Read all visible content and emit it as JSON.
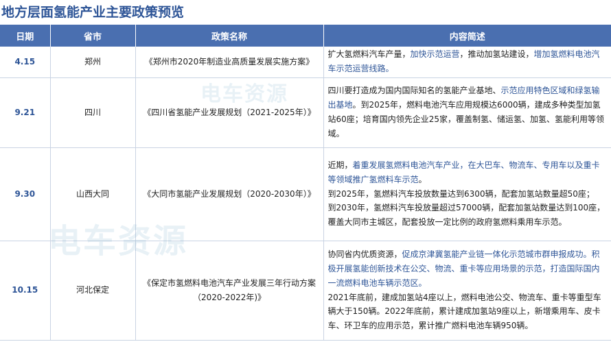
{
  "title": "地方层面氢能产业主要政策预览",
  "headers": {
    "date": "日期",
    "city": "省市",
    "policy": "政策名称",
    "content": "内容简述"
  },
  "rows": [
    {
      "date": "4.15",
      "city": "郑州",
      "policy": "《郑州市2020年制造业高质量发展实施方案》",
      "content": [
        {
          "t": "扩大氢燃料汽车产量，",
          "hl": false
        },
        {
          "t": "加快示范运营",
          "hl": true
        },
        {
          "t": "，推动加氢站建设，",
          "hl": false
        },
        {
          "t": "增加氢燃料电池汽车示范运营线路。",
          "hl": true
        }
      ]
    },
    {
      "date": "9.21",
      "city": "四川",
      "policy": "《四川省氢能产业发展规划（2021-2025年）》",
      "content": [
        {
          "t": "四川要打造成为国内国际知名的氢能产业基地、",
          "hl": false
        },
        {
          "t": "示范应用特色区域和绿氢输出基地",
          "hl": true
        },
        {
          "t": "。到2025年，燃料电池汽车应用规模达6000辆，建成多种类型加氢站60座；培育国内领先企业25家，覆盖制氢、储运氢、加氢、氢能利用等领域。",
          "hl": false
        }
      ]
    },
    {
      "date": "9.30",
      "city": "山西大同",
      "policy": "《大同市氢能产业发展规划（2020-2030年）》",
      "content_paras": [
        [
          {
            "t": "近期，",
            "hl": false
          },
          {
            "t": "着重发展氢燃料电池汽车产业，在大巴车、物流车、专用车以及重卡等领域推广氢燃料车示范",
            "hl": true
          },
          {
            "t": "。",
            "hl": false
          }
        ],
        [
          {
            "t": "到2025年，氢燃料汽车投放数量达到6300辆，配套加氢站数量超50座；",
            "hl": false
          }
        ],
        [
          {
            "t": "到2030年，氢燃料汽车投放量超过57000辆，配套加氢站数量达到100座，覆盖大同市主城区，配套投放一定比例的政府氢燃料乘用车示范。",
            "hl": false
          }
        ]
      ]
    },
    {
      "date": "10.15",
      "city": "河北保定",
      "policy": "《保定市氢燃料电池汽车产业发展三年行动方案（2020-2022年)》",
      "content_paras": [
        [
          {
            "t": "协同省内优质资源，",
            "hl": false
          },
          {
            "t": "促成京津冀氢能产业链一体化示范城市群申报成功。积极开展氢能创新技术在公交、物流、重卡等应用场景的示范，打造国际国内一流燃料电池车辆示范区。",
            "hl": true
          }
        ],
        [
          {
            "t": "2021年底前，建成加氢站4座以上，燃料电池公交、物流车、重卡等重型车辆大于150辆。2022年底前，累计建成加氢站9座以上，新增乘用车、皮卡车、环卫车的应用示范，累计推广燃料电池车辆950辆。",
            "hl": false
          }
        ]
      ]
    }
  ],
  "watermark": "电车资源",
  "colors": {
    "title": "#2e5597",
    "header_bg": "#4a6fb0",
    "highlight": "#2e5597",
    "grid": "#c9d3e3"
  }
}
